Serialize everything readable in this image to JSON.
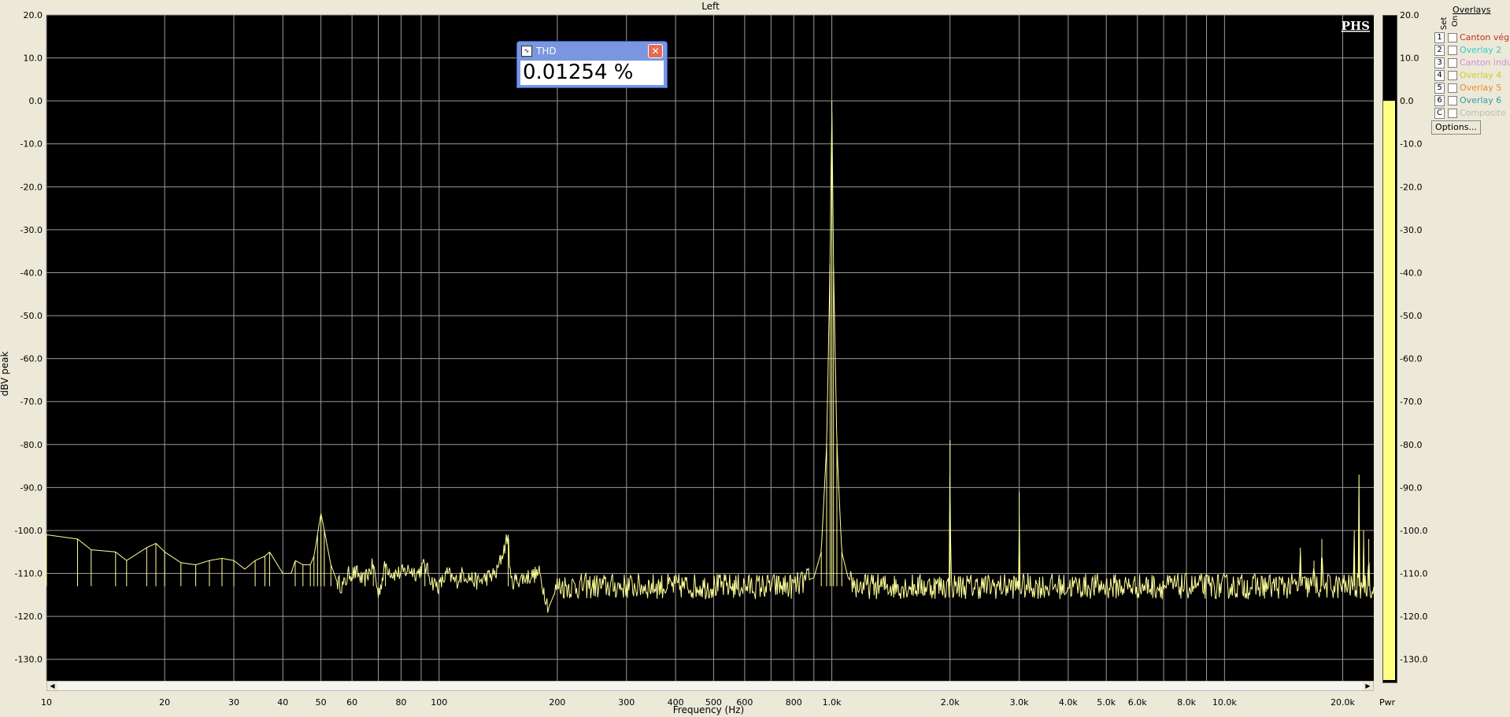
{
  "chart_data": {
    "type": "line",
    "title": "Left",
    "xlabel": "Frequency (Hz)",
    "ylabel": "dBV peak",
    "x_scale": "log",
    "xlim": [
      10,
      24000
    ],
    "ylim": [
      -135,
      20
    ],
    "x_ticks": [
      "10",
      "20",
      "30",
      "40",
      "50",
      "60",
      "80",
      "100",
      "200",
      "300",
      "400",
      "500",
      "600",
      "800",
      "1.0k",
      "2.0k",
      "3.0k",
      "4.0k",
      "5.0k",
      "6.0k",
      "8.0k",
      "10.0k",
      "20.0k"
    ],
    "y_ticks": [
      "20.0",
      "10.0",
      "0.0",
      "-10.0",
      "-20.0",
      "-30.0",
      "-40.0",
      "-50.0",
      "-60.0",
      "-70.0",
      "-80.0",
      "-90.0",
      "-100.0",
      "-110.0",
      "-120.0",
      "-130.0"
    ],
    "grid": true,
    "background": "#000000",
    "line_color": "#ffff99",
    "grid_color": "#9a9a9a",
    "series": [
      {
        "noise_floor": -113,
        "points": [
          [
            10,
            -101
          ],
          [
            12,
            -102
          ],
          [
            13,
            -104.5
          ],
          [
            15,
            -105
          ],
          [
            16,
            -107
          ],
          [
            18,
            -104
          ],
          [
            19,
            -103
          ],
          [
            20,
            -105
          ],
          [
            22,
            -107.5
          ],
          [
            24,
            -108
          ],
          [
            26,
            -107
          ],
          [
            28,
            -106.5
          ],
          [
            30,
            -107
          ],
          [
            32,
            -109
          ],
          [
            34,
            -107
          ],
          [
            36,
            -106
          ],
          [
            37,
            -105
          ],
          [
            40,
            -110
          ],
          [
            42,
            -110
          ],
          [
            43,
            -107
          ],
          [
            45,
            -108
          ],
          [
            47,
            -108
          ],
          [
            48,
            -106
          ],
          [
            49,
            -101
          ],
          [
            50,
            -96
          ],
          [
            51,
            -100
          ],
          [
            53,
            -108
          ],
          [
            55,
            -112
          ],
          [
            57,
            -113
          ],
          [
            59,
            -110
          ],
          [
            62,
            -110
          ],
          [
            64,
            -112
          ],
          [
            66,
            -110
          ],
          [
            68,
            -108
          ],
          [
            70,
            -115
          ],
          [
            73,
            -108
          ],
          [
            76,
            -110
          ],
          [
            80,
            -110
          ],
          [
            84,
            -109
          ],
          [
            88,
            -110
          ],
          [
            92,
            -108
          ],
          [
            96,
            -112
          ],
          [
            100,
            -113
          ],
          [
            105,
            -110
          ],
          [
            110,
            -112
          ],
          [
            115,
            -110
          ],
          [
            125,
            -112
          ],
          [
            140,
            -110
          ],
          [
            150,
            -101
          ],
          [
            152,
            -112
          ],
          [
            165,
            -111
          ],
          [
            180,
            -110
          ],
          [
            190,
            -118
          ],
          [
            200,
            -113
          ],
          [
            300,
            -113
          ],
          [
            500,
            -113
          ],
          [
            800,
            -113
          ],
          [
            900,
            -111
          ],
          [
            940,
            -105
          ],
          [
            970,
            -80
          ],
          [
            990,
            -38
          ],
          [
            1000,
            0
          ],
          [
            1010,
            -38
          ],
          [
            1030,
            -80
          ],
          [
            1060,
            -105
          ],
          [
            1100,
            -111
          ],
          [
            1150,
            -113
          ],
          [
            1990,
            -113
          ],
          [
            2000,
            -79
          ],
          [
            2010,
            -113
          ],
          [
            2990,
            -113
          ],
          [
            3000,
            -91
          ],
          [
            3010,
            -113
          ],
          [
            15500,
            -113
          ],
          [
            15600,
            -104
          ],
          [
            15700,
            -113
          ],
          [
            16800,
            -113
          ],
          [
            16900,
            -107
          ],
          [
            17000,
            -113
          ],
          [
            17600,
            -113
          ],
          [
            17700,
            -102
          ],
          [
            17800,
            -113
          ],
          [
            21300,
            -113
          ],
          [
            21400,
            -100
          ],
          [
            21500,
            -113
          ],
          [
            21900,
            -113
          ],
          [
            22000,
            -87
          ],
          [
            22100,
            -113
          ],
          [
            22500,
            -113
          ],
          [
            22600,
            -100
          ],
          [
            22700,
            -113
          ],
          [
            23200,
            -113
          ],
          [
            23300,
            -102
          ],
          [
            23400,
            -113
          ],
          [
            24000,
            -113
          ]
        ]
      }
    ]
  },
  "thd_window": {
    "title": "THD",
    "value": "0.01254 %",
    "close_symbol": "✕"
  },
  "meter": {
    "ticks": [
      "20.0",
      "10.0",
      "0.0",
      "-10.0",
      "-20.0",
      "-30.0",
      "-40.0",
      "-50.0",
      "-60.0",
      "-70.0",
      "-80.0",
      "-90.0",
      "-100.0",
      "-110.0",
      "-120.0",
      "-130.0"
    ],
    "level_db": 0,
    "fill_color": "#ffff80",
    "label": "Pwr"
  },
  "overlays": {
    "header": "Overlays",
    "set_label": "Set",
    "on_label": "On",
    "items": [
      {
        "num": "1",
        "name": "Canton vég",
        "color": "#cc2a1a"
      },
      {
        "num": "2",
        "name": "Overlay 2",
        "color": "#33cccc"
      },
      {
        "num": "3",
        "name": "Canton indu",
        "color": "#dd88dd"
      },
      {
        "num": "4",
        "name": "Overlay 4",
        "color": "#cccc33"
      },
      {
        "num": "5",
        "name": "Overlay 5",
        "color": "#ee8833"
      },
      {
        "num": "6",
        "name": "Overlay 6",
        "color": "#3399aa"
      },
      {
        "num": "C",
        "name": "Composite",
        "color": "#bbbbbb"
      }
    ],
    "options_label": "Options..."
  },
  "branding": {
    "logo_text": "PHS"
  },
  "scroll": {
    "left_arrow": "◀",
    "right_arrow": "▶"
  }
}
